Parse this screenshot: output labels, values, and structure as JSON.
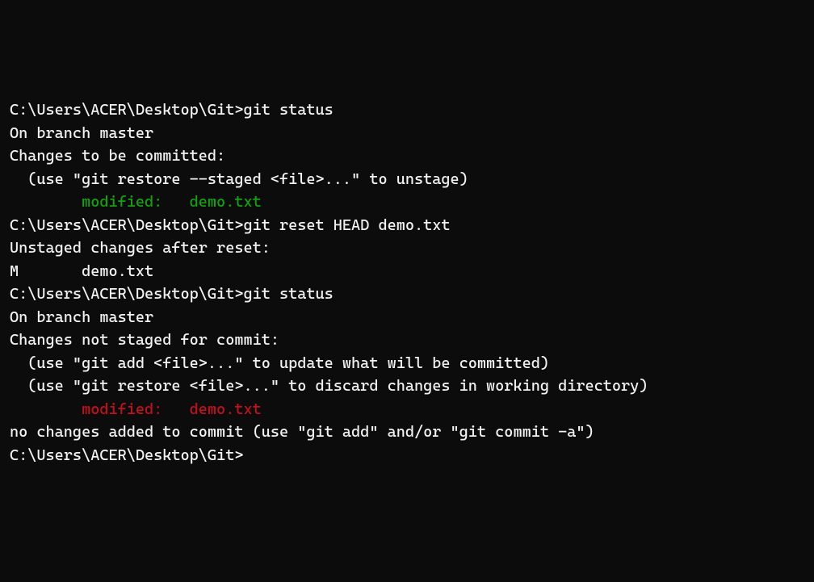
{
  "lines": {
    "l1_prompt": "C:\\Users\\ACER\\Desktop\\Git>",
    "l1_cmd": "git status",
    "l2": "On branch master",
    "l3": "Changes to be committed:",
    "l4": "  (use \"git restore --staged <file>...\" to unstage)",
    "l5": "        modified:   demo.txt",
    "l6": "",
    "l7": "",
    "l8_prompt": "C:\\Users\\ACER\\Desktop\\Git>",
    "l8_cmd": "git reset HEAD demo.txt",
    "l9": "Unstaged changes after reset:",
    "l10": "M       demo.txt",
    "l11": "",
    "l12_prompt": "C:\\Users\\ACER\\Desktop\\Git>",
    "l12_cmd": "git status",
    "l13": "On branch master",
    "l14": "Changes not staged for commit:",
    "l15": "  (use \"git add <file>...\" to update what will be committed)",
    "l16": "  (use \"git restore <file>...\" to discard changes in working directory)",
    "l17": "        modified:   demo.txt",
    "l18": "",
    "l19": "no changes added to commit (use \"git add\" and/or \"git commit -a\")",
    "l20": "",
    "l21_prompt": "C:\\Users\\ACER\\Desktop\\Git>"
  }
}
